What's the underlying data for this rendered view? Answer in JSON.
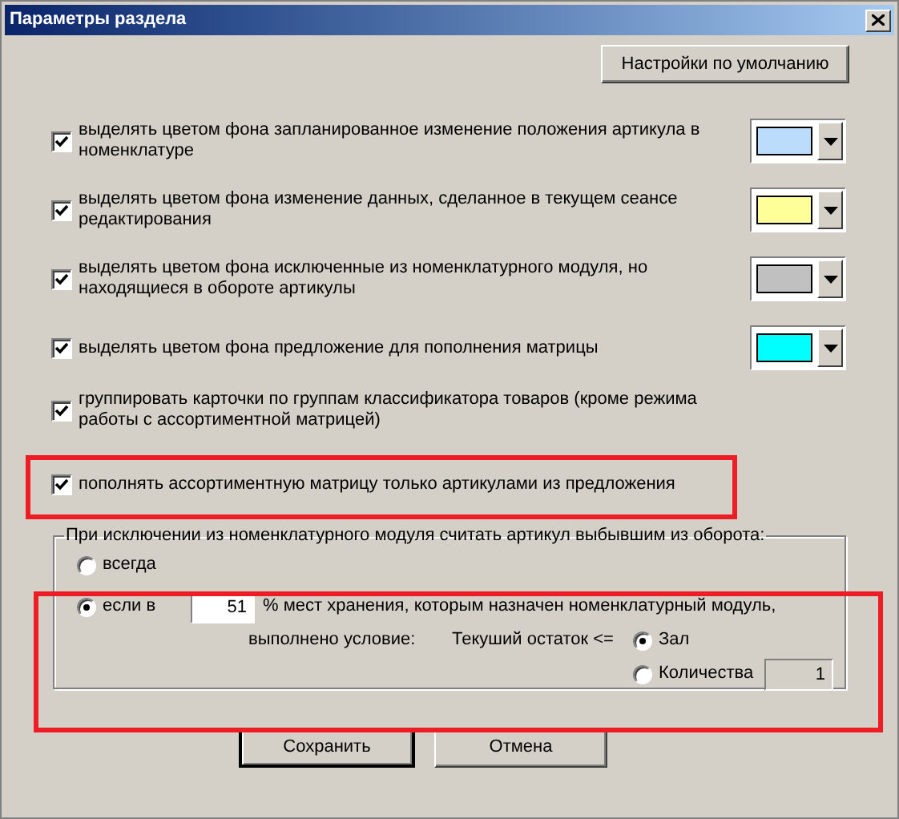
{
  "window": {
    "title": "Параметры раздела"
  },
  "default_button": "Настройки по умолчанию",
  "options": [
    {
      "label": "выделять цветом фона запланированное изменение положения артикула в номенклатуре",
      "checked": true,
      "kind": "color",
      "color": "#bcdcfc"
    },
    {
      "label": "выделять цветом фона изменение данных, сделанное  в текущем сеансе редактирования",
      "checked": true,
      "kind": "color",
      "color": "#ffff99"
    },
    {
      "label": "выделять цветом фона исключенные из номенклатурного модуля, но находящиеся в обороте артикулы",
      "checked": true,
      "kind": "color",
      "color": "#c0c0c0"
    },
    {
      "label": "выделять цветом фона предложение для пополнения матрицы",
      "checked": true,
      "kind": "color",
      "color": "#00ffff"
    },
    {
      "label": "группировать карточки по группам классификатора товаров (кроме режима работы с ассортиментной матрицей)",
      "checked": true,
      "kind": "plain"
    },
    {
      "label": "пополнять ассортиментную матрицу только артикулами из предложения",
      "checked": true,
      "kind": "plain"
    }
  ],
  "group": {
    "legend": "При исключении из номенклатурного модуля считать артикул выбывшим из оборота:",
    "choices": [
      {
        "label": "всегда",
        "selected": false
      },
      {
        "label": "если в",
        "selected": true
      }
    ],
    "percent": "51",
    "percent_text": "% мест хранения, которым назначен номенклатурный модуль,",
    "condition_label": "выполнено условие:",
    "stock_label": "Текуший остаток <=",
    "stock_choices": [
      {
        "label": "Зал",
        "selected": true
      },
      {
        "label": "Количества",
        "selected": false
      }
    ],
    "quantity": "1"
  },
  "buttons": [
    "Сохранить",
    "Отмена"
  ]
}
